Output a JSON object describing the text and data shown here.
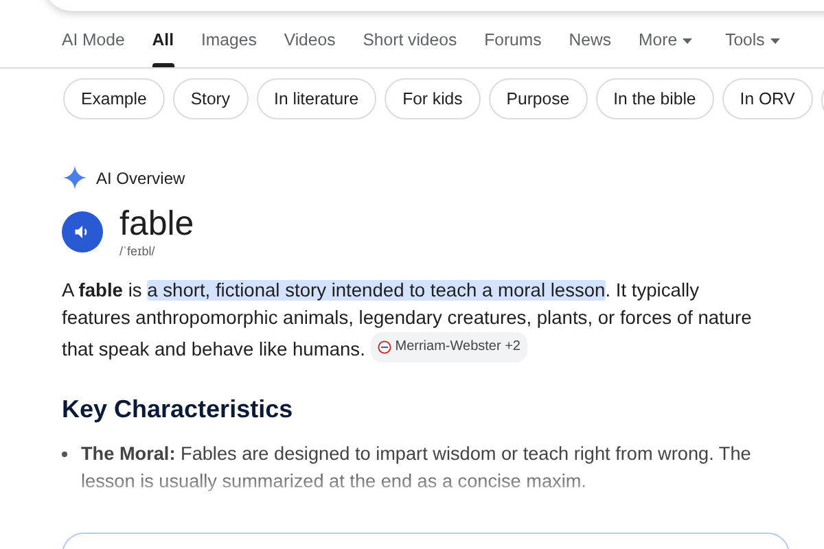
{
  "tabs": [
    {
      "label": "AI Mode",
      "selected": false,
      "dropdown": false
    },
    {
      "label": "All",
      "selected": true,
      "dropdown": false
    },
    {
      "label": "Images",
      "selected": false,
      "dropdown": false
    },
    {
      "label": "Videos",
      "selected": false,
      "dropdown": false
    },
    {
      "label": "Short videos",
      "selected": false,
      "dropdown": false
    },
    {
      "label": "Forums",
      "selected": false,
      "dropdown": false
    },
    {
      "label": "News",
      "selected": false,
      "dropdown": false
    },
    {
      "label": "More",
      "selected": false,
      "dropdown": true
    },
    {
      "label": "Tools",
      "selected": false,
      "dropdown": true
    }
  ],
  "chips": [
    "Example",
    "Story",
    "In literature",
    "For kids",
    "Purpose",
    "In the bible",
    "In ORV"
  ],
  "ai_overview": {
    "label": "AI Overview",
    "word": "fable",
    "pronunciation": "/ˈfeɪbl/",
    "definition_before": "A **fable** is ",
    "definition_highlight": "a short, fictional story intended to teach a moral lesson",
    "definition_after": ". It typically features anthropomorphic animals, legendary creatures, plants, or forces of nature that speak and behave like humans.",
    "source": "Merriam-Webster +2",
    "heading": "Key Characteristics",
    "bullets": [
      "**The Moral:** Fables are designed to impart wisdom or teach right from wrong. The lesson is usually summarized at the end as a concise maxim."
    ]
  }
}
